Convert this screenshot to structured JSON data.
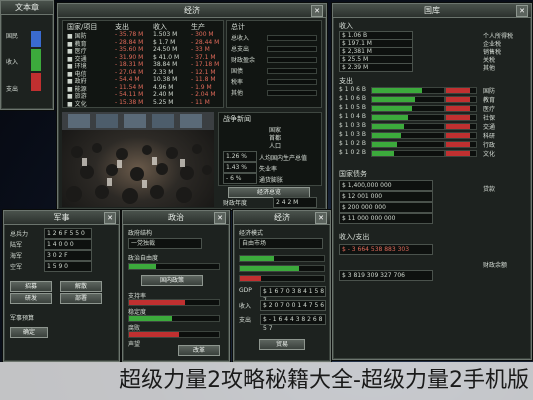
{
  "left_sidebar": {
    "title": "文本章",
    "close": "X",
    "legend": [
      {
        "label": "国民",
        "color": "#3a6bd0"
      },
      {
        "label": "收入",
        "color": "#3caa3c"
      },
      {
        "label": "支出",
        "color": "#c03030"
      }
    ]
  },
  "budget_panel": {
    "title": "经济",
    "col_headers": [
      "国家/项目",
      "支出",
      "收入",
      "生产"
    ],
    "rows": [
      [
        "■ 国防",
        "- 35.78 M",
        "1.503 M",
        "- 300 M"
      ],
      [
        "■ 教育",
        "- 28.84 M",
        "$ 1.7 M",
        "- 28.44 M"
      ],
      [
        "■ 医疗",
        "- 35.60 M",
        "24.50 M",
        "- 33 M"
      ],
      [
        "■ 交通",
        "- 31.90 M",
        "$ 41.0 M",
        "- 37.1 M"
      ],
      [
        "■ 环境",
        "- 18.31 M",
        "38.84 M",
        "- 17.18 M"
      ],
      [
        "■ 电信",
        "- 27.04 M",
        "2.33 M",
        "- 12.1 M"
      ],
      [
        "■ 政府",
        "- 54.4 M",
        "10.38 M",
        "- 11.8 M"
      ],
      [
        "■ 能源",
        "- 11.54 M",
        "4.96 M",
        "- 1.9 M"
      ],
      [
        "■ 旅游",
        "- 54.11 M",
        "2.40 M",
        "- 2.04 M"
      ],
      [
        "■ 文化",
        "- 15.38 M",
        "5.25 M",
        "- 11 M"
      ]
    ],
    "side_header": "总计",
    "side_values": [
      "总收入",
      "总支出",
      "财政盈余",
      "国债",
      "税率",
      "其他"
    ],
    "subpanel_title": "战争新闻",
    "info_labels": [
      "国家",
      "首都",
      "人口",
      "财政",
      "外交"
    ],
    "info_values": [
      "",
      "",
      "",
      "",
      ""
    ],
    "stat_fields": [
      "1.26 %",
      "1.43 %",
      "- 6 %"
    ],
    "stat_labels": [
      "人均国内生产总值",
      "失业率",
      "通货膨胀"
    ],
    "bottom_btn": "经济总览",
    "bottom_label": "财政年度",
    "bottom_field": "2 4 2 M"
  },
  "treasury_panel": {
    "title": "国库",
    "section1": "收入",
    "rows1": [
      {
        "label": "个人所得税",
        "value": "$ 1.06 B"
      },
      {
        "label": "企业税",
        "value": "$ 197.1 M"
      },
      {
        "label": "销售税",
        "value": "$ 2,381 M"
      },
      {
        "label": "关税",
        "value": "$ 25.5 M"
      },
      {
        "label": "其他",
        "value": "$ 2.39 M"
      }
    ],
    "section2": "支出",
    "rows2": [
      {
        "label": "国防",
        "value": "$ 1 0 6 B",
        "fill": 0.7
      },
      {
        "label": "教育",
        "value": "$ 1 0 6 B",
        "fill": 0.6
      },
      {
        "label": "医疗",
        "value": "$ 1 0 5 B",
        "fill": 0.55
      },
      {
        "label": "社保",
        "value": "$ 1 0 4 B",
        "fill": 0.5
      },
      {
        "label": "交通",
        "value": "$ 1 0 3 B",
        "fill": 0.45
      },
      {
        "label": "科研",
        "value": "$ 1 0 3 B",
        "fill": 0.4
      },
      {
        "label": "行政",
        "value": "$ 1 0 2 B",
        "fill": 0.35
      },
      {
        "label": "文化",
        "value": "$ 1 0 2 B",
        "fill": 0.3
      }
    ],
    "section3": "国家债务",
    "rows3": [
      "$ 1,400,000 000",
      "$ 12 001 000",
      "$ 200 000 000",
      "$ 11 000 000 000"
    ],
    "section3_label": "贷款",
    "section4": "收入/支出",
    "totals": [
      "$ - 3 664 538 883 303",
      "$ 3 819 309 327 706"
    ],
    "total_label": "财政余额"
  },
  "small1": {
    "title": "军事",
    "rows": [
      {
        "label": "总兵力",
        "value": "1 2 6 F 5 5 0"
      },
      {
        "label": "陆军",
        "value": "1 4 0 0 0"
      },
      {
        "label": "海军",
        "value": "3 0 2 F"
      },
      {
        "label": "空军",
        "value": "1 5 9 0"
      }
    ],
    "buttons": [
      "招募",
      "解散",
      "研发",
      "部署"
    ],
    "label2": "军事预算",
    "btn2": "确定"
  },
  "small2": {
    "title": "政治",
    "label": "政府结构",
    "field": "一党独裁",
    "label2": "政治自由度",
    "btn": "国内政策",
    "bar_labels": [
      "支持率",
      "稳定度",
      "腐败",
      "声望"
    ],
    "btn2": "改革"
  },
  "small3": {
    "title": "经济",
    "field1": "经济模式",
    "field2": "自由市场",
    "bars": [
      "",
      "",
      ""
    ],
    "rows": [
      {
        "label": "GDP",
        "value": "$ 1 6 7 0 3 8 4 1 5 8 7"
      },
      {
        "label": "收入",
        "value": "$ 2 0 7 0 0 1 4 7 5 6"
      },
      {
        "label": "支出",
        "value": "$ - 1 6 4 4 3 8 2 6 8 5 7"
      }
    ],
    "btn": "贸易"
  },
  "banner_text": "超级力量2攻略秘籍大全-超级力量2手机版"
}
